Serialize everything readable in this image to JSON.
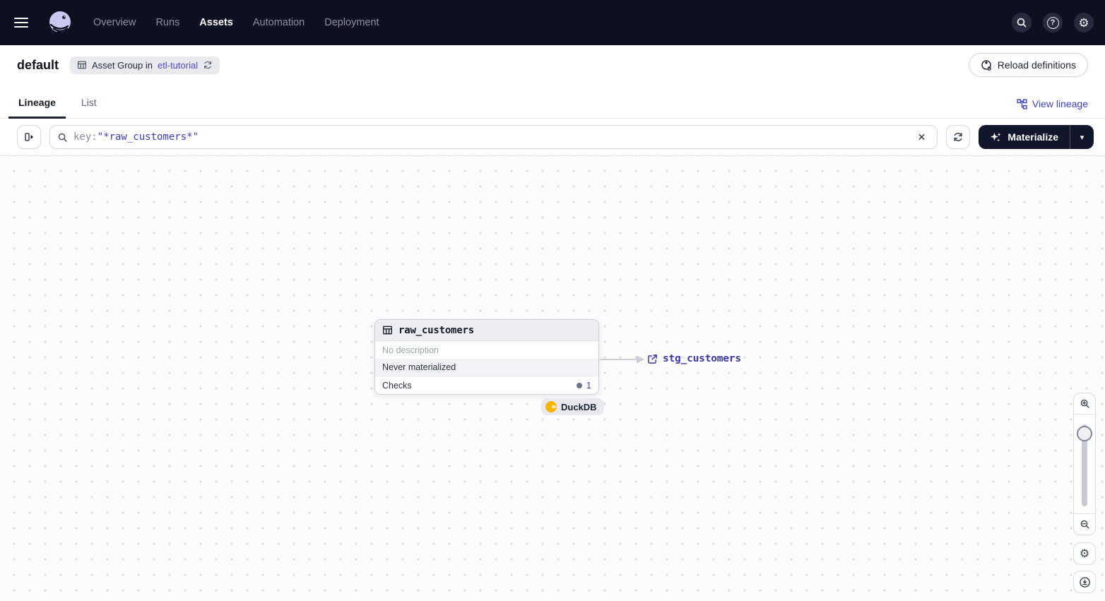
{
  "topnav": {
    "items": [
      {
        "label": "Overview",
        "active": false
      },
      {
        "label": "Runs",
        "active": false
      },
      {
        "label": "Assets",
        "active": true
      },
      {
        "label": "Automation",
        "active": false
      },
      {
        "label": "Deployment",
        "active": false
      }
    ]
  },
  "header": {
    "title": "default",
    "badge_prefix": "Asset Group in",
    "badge_link": "etl-tutorial",
    "reload_label": "Reload definitions"
  },
  "tabs": {
    "lineage": "Lineage",
    "list": "List",
    "view_lineage": "View lineage"
  },
  "toolbar": {
    "search_prefix": "key:",
    "search_value": "\"*raw_customers*\"",
    "materialize_label": "Materialize"
  },
  "graph": {
    "node": {
      "title": "raw_customers",
      "description": "No description",
      "status": "Never materialized",
      "checks_label": "Checks",
      "checks_count": "1"
    },
    "kind_tag": "DuckDB",
    "downstream_label": "stg_customers"
  },
  "glyphs": {
    "question": "?",
    "gear": "⚙",
    "close": "✕",
    "caret_down": "▾"
  },
  "icons": {
    "names": [
      "menu-icon",
      "dagster-logo",
      "search-icon",
      "help-icon",
      "settings-icon",
      "table-icon",
      "refresh-icon",
      "reload-icon",
      "view-lineage-icon",
      "panel-toggle-icon",
      "sparkle-icon",
      "caret-down-icon",
      "close-icon",
      "external-link-icon",
      "duckdb-icon",
      "zoom-in-icon",
      "zoom-out-icon",
      "recenter-icon"
    ]
  },
  "colors": {
    "topnav_bg": "#0d1020",
    "accent_indigo": "#3b3ac0",
    "link_purple": "#4f46d6",
    "materialize_bg": "#11162a",
    "duckdb_yellow": "#f9b500",
    "badge_bg": "#e9eaee",
    "canvas_dot": "#d8dade",
    "edge_gray": "#c9cdd5"
  }
}
